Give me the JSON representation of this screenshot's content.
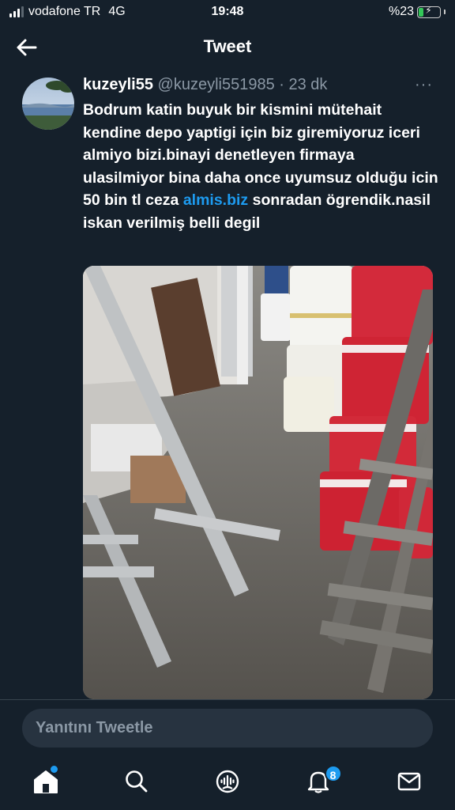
{
  "status_bar": {
    "carrier": "vodafone TR",
    "network": "4G",
    "time": "19:48",
    "battery_percent": "%23",
    "battery_level": 0.23,
    "signal_bars_active": 3
  },
  "header": {
    "title": "Tweet"
  },
  "tweet": {
    "display_name": "kuzeyli55",
    "handle": "@kuzeyli551985",
    "separator": "·",
    "time": "23 dk",
    "text_before_link": "Bodrum katin buyuk bir kismini mütehait kendine depo yaptigi için biz giremiyoruz iceri almiyo bizi.binayi denetleyen firmaya ulasilmiyor bina daha once uyumsuz olduğu icin 50 bin tl ceza ",
    "link_text": "almis.biz",
    "text_after_link": " sonradan ögrendik.nasil iskan verilmiş belli degil",
    "more_label": "···"
  },
  "reply": {
    "placeholder": "Yanıtını Tweetle"
  },
  "tabs": [
    {
      "name": "home",
      "icon": "home-icon",
      "has_dot": true
    },
    {
      "name": "search",
      "icon": "search-icon"
    },
    {
      "name": "spaces",
      "icon": "spaces-icon"
    },
    {
      "name": "notifications",
      "icon": "bell-icon",
      "badge": "8"
    },
    {
      "name": "messages",
      "icon": "envelope-icon"
    }
  ],
  "colors": {
    "background": "#15202b",
    "accent": "#1d9bf0",
    "secondary_text": "#8b98a5",
    "battery": "#34c759"
  }
}
